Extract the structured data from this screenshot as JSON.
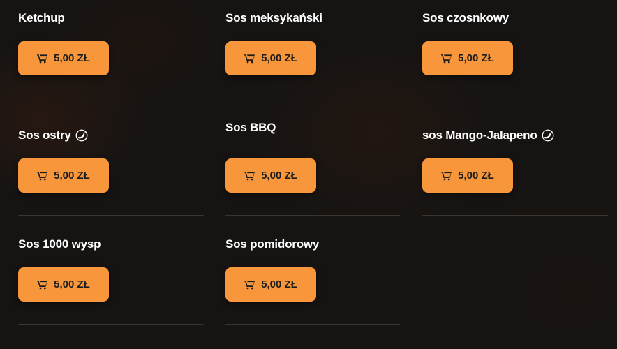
{
  "products": [
    {
      "name": "Ketchup",
      "price": "5,00 ZŁ",
      "spicy": false
    },
    {
      "name": "Sos meksykański",
      "price": "5,00 ZŁ",
      "spicy": false
    },
    {
      "name": "Sos czosnkowy",
      "price": "5,00 ZŁ",
      "spicy": false
    },
    {
      "name": "Sos ostry",
      "price": "5,00 ZŁ",
      "spicy": true
    },
    {
      "name": "Sos BBQ",
      "price": "5,00 ZŁ",
      "spicy": false
    },
    {
      "name": "sos Mango-Jalapeno",
      "price": "5,00 ZŁ",
      "spicy": true
    },
    {
      "name": "Sos 1000 wysp",
      "price": "5,00 ZŁ",
      "spicy": false
    },
    {
      "name": "Sos pomidorowy",
      "price": "5,00 ZŁ",
      "spicy": false
    }
  ],
  "icons": {
    "cart": "cart-icon",
    "spicy": "chili-pepper-icon"
  },
  "colors": {
    "button": "#f7963a",
    "background": "#161412",
    "text": "#ffffff"
  }
}
